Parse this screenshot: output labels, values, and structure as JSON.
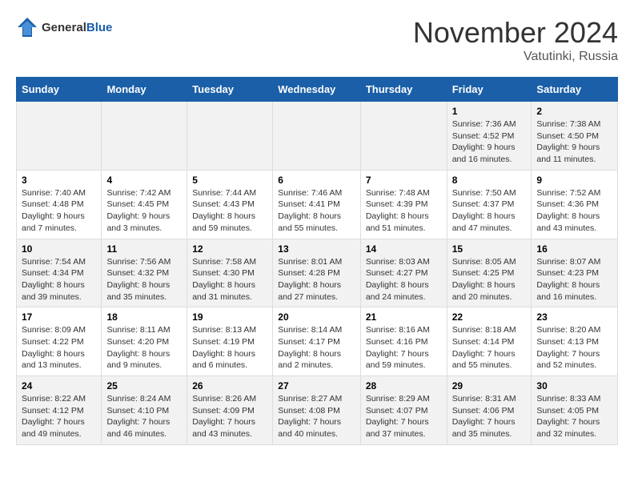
{
  "logo": {
    "general": "General",
    "blue": "Blue"
  },
  "header": {
    "title": "November 2024",
    "subtitle": "Vatutinki, Russia"
  },
  "weekdays": [
    "Sunday",
    "Monday",
    "Tuesday",
    "Wednesday",
    "Thursday",
    "Friday",
    "Saturday"
  ],
  "weeks": [
    {
      "days": [
        {
          "num": "",
          "info": ""
        },
        {
          "num": "",
          "info": ""
        },
        {
          "num": "",
          "info": ""
        },
        {
          "num": "",
          "info": ""
        },
        {
          "num": "",
          "info": ""
        },
        {
          "num": "1",
          "info": "Sunrise: 7:36 AM\nSunset: 4:52 PM\nDaylight: 9 hours and 16 minutes."
        },
        {
          "num": "2",
          "info": "Sunrise: 7:38 AM\nSunset: 4:50 PM\nDaylight: 9 hours and 11 minutes."
        }
      ]
    },
    {
      "days": [
        {
          "num": "3",
          "info": "Sunrise: 7:40 AM\nSunset: 4:48 PM\nDaylight: 9 hours and 7 minutes."
        },
        {
          "num": "4",
          "info": "Sunrise: 7:42 AM\nSunset: 4:45 PM\nDaylight: 9 hours and 3 minutes."
        },
        {
          "num": "5",
          "info": "Sunrise: 7:44 AM\nSunset: 4:43 PM\nDaylight: 8 hours and 59 minutes."
        },
        {
          "num": "6",
          "info": "Sunrise: 7:46 AM\nSunset: 4:41 PM\nDaylight: 8 hours and 55 minutes."
        },
        {
          "num": "7",
          "info": "Sunrise: 7:48 AM\nSunset: 4:39 PM\nDaylight: 8 hours and 51 minutes."
        },
        {
          "num": "8",
          "info": "Sunrise: 7:50 AM\nSunset: 4:37 PM\nDaylight: 8 hours and 47 minutes."
        },
        {
          "num": "9",
          "info": "Sunrise: 7:52 AM\nSunset: 4:36 PM\nDaylight: 8 hours and 43 minutes."
        }
      ]
    },
    {
      "days": [
        {
          "num": "10",
          "info": "Sunrise: 7:54 AM\nSunset: 4:34 PM\nDaylight: 8 hours and 39 minutes."
        },
        {
          "num": "11",
          "info": "Sunrise: 7:56 AM\nSunset: 4:32 PM\nDaylight: 8 hours and 35 minutes."
        },
        {
          "num": "12",
          "info": "Sunrise: 7:58 AM\nSunset: 4:30 PM\nDaylight: 8 hours and 31 minutes."
        },
        {
          "num": "13",
          "info": "Sunrise: 8:01 AM\nSunset: 4:28 PM\nDaylight: 8 hours and 27 minutes."
        },
        {
          "num": "14",
          "info": "Sunrise: 8:03 AM\nSunset: 4:27 PM\nDaylight: 8 hours and 24 minutes."
        },
        {
          "num": "15",
          "info": "Sunrise: 8:05 AM\nSunset: 4:25 PM\nDaylight: 8 hours and 20 minutes."
        },
        {
          "num": "16",
          "info": "Sunrise: 8:07 AM\nSunset: 4:23 PM\nDaylight: 8 hours and 16 minutes."
        }
      ]
    },
    {
      "days": [
        {
          "num": "17",
          "info": "Sunrise: 8:09 AM\nSunset: 4:22 PM\nDaylight: 8 hours and 13 minutes."
        },
        {
          "num": "18",
          "info": "Sunrise: 8:11 AM\nSunset: 4:20 PM\nDaylight: 8 hours and 9 minutes."
        },
        {
          "num": "19",
          "info": "Sunrise: 8:13 AM\nSunset: 4:19 PM\nDaylight: 8 hours and 6 minutes."
        },
        {
          "num": "20",
          "info": "Sunrise: 8:14 AM\nSunset: 4:17 PM\nDaylight: 8 hours and 2 minutes."
        },
        {
          "num": "21",
          "info": "Sunrise: 8:16 AM\nSunset: 4:16 PM\nDaylight: 7 hours and 59 minutes."
        },
        {
          "num": "22",
          "info": "Sunrise: 8:18 AM\nSunset: 4:14 PM\nDaylight: 7 hours and 55 minutes."
        },
        {
          "num": "23",
          "info": "Sunrise: 8:20 AM\nSunset: 4:13 PM\nDaylight: 7 hours and 52 minutes."
        }
      ]
    },
    {
      "days": [
        {
          "num": "24",
          "info": "Sunrise: 8:22 AM\nSunset: 4:12 PM\nDaylight: 7 hours and 49 minutes."
        },
        {
          "num": "25",
          "info": "Sunrise: 8:24 AM\nSunset: 4:10 PM\nDaylight: 7 hours and 46 minutes."
        },
        {
          "num": "26",
          "info": "Sunrise: 8:26 AM\nSunset: 4:09 PM\nDaylight: 7 hours and 43 minutes."
        },
        {
          "num": "27",
          "info": "Sunrise: 8:27 AM\nSunset: 4:08 PM\nDaylight: 7 hours and 40 minutes."
        },
        {
          "num": "28",
          "info": "Sunrise: 8:29 AM\nSunset: 4:07 PM\nDaylight: 7 hours and 37 minutes."
        },
        {
          "num": "29",
          "info": "Sunrise: 8:31 AM\nSunset: 4:06 PM\nDaylight: 7 hours and 35 minutes."
        },
        {
          "num": "30",
          "info": "Sunrise: 8:33 AM\nSunset: 4:05 PM\nDaylight: 7 hours and 32 minutes."
        }
      ]
    }
  ]
}
